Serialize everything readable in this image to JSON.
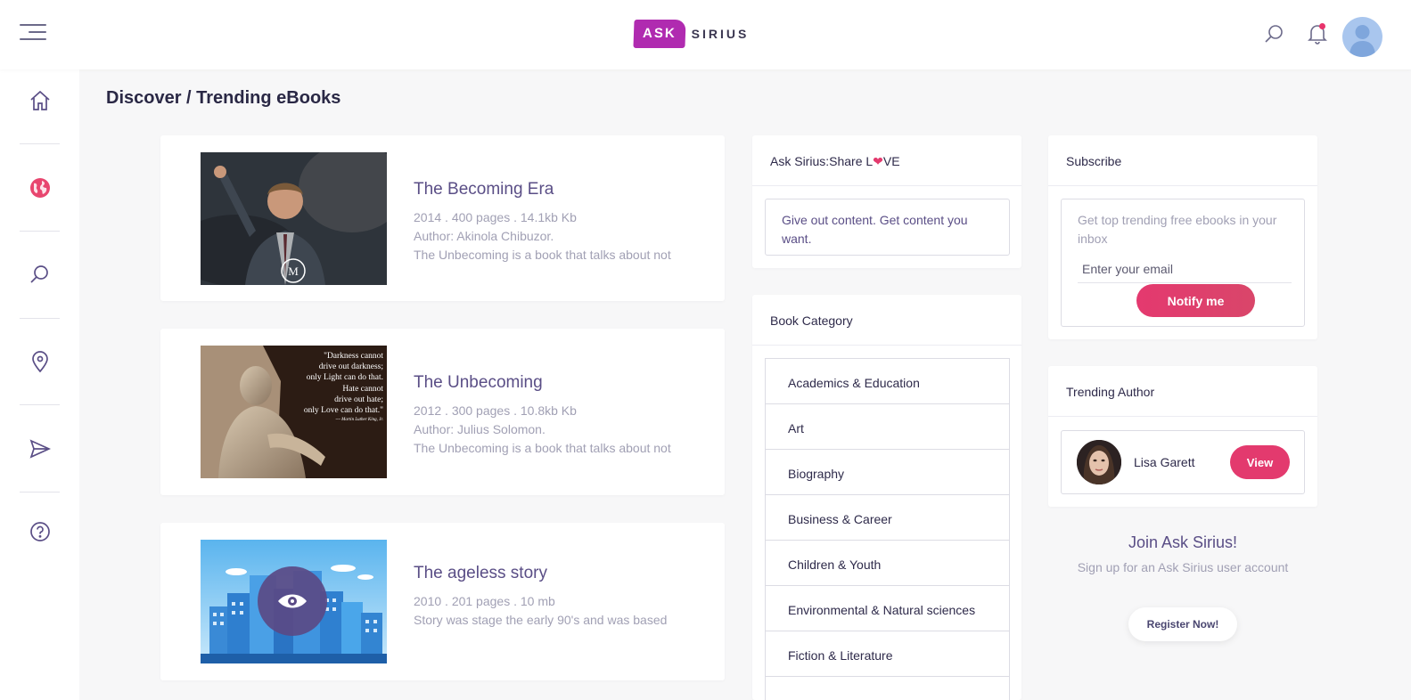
{
  "header": {
    "logo_ask": "ASK",
    "logo_sirius": "SIRIUS"
  },
  "sidebar": {
    "items": [
      {
        "name": "home",
        "active": false
      },
      {
        "name": "globe",
        "active": true
      },
      {
        "name": "search",
        "active": false
      },
      {
        "name": "location",
        "active": false
      },
      {
        "name": "send",
        "active": false
      },
      {
        "name": "help",
        "active": false
      }
    ]
  },
  "page": {
    "breadcrumb": "Discover / Trending eBooks"
  },
  "books": [
    {
      "title": "The Becoming Era",
      "meta": "2014 . 400 pages . 14.1kb Kb",
      "author": "Author: Akinola Chibuzor.",
      "desc": "The Unbecoming is a book that talks about not"
    },
    {
      "title": "The Unbecoming",
      "meta": "2012 . 300 pages . 10.8kb Kb",
      "author": "Author: Julius Solomon.",
      "desc": "The Unbecoming is a book that talks about not",
      "quote_lines": [
        "\"Darkness cannot",
        "drive out darkness;",
        "only Light can do that.",
        "Hate cannot",
        "drive out hate;",
        "only Love can do that.\"",
        "~~ Martin Luther King, Jr."
      ]
    },
    {
      "title": "The ageless story",
      "meta": "2010 . 201 pages . 10 mb",
      "desc": "Story was stage the early 90's and was based"
    }
  ],
  "share_panel": {
    "title_prefix": "Ask Sirius:Share L",
    "title_suffix": "VE",
    "body": "Give out content. Get content you want."
  },
  "category_panel": {
    "title": "Book Category",
    "items": [
      "Academics & Education",
      "Art",
      "Biography",
      "Business & Career",
      "Children & Youth",
      "Environmental & Natural sciences",
      "Fiction & Literature"
    ]
  },
  "subscribe_panel": {
    "title": "Subscribe",
    "description": "Get top trending free ebooks in your inbox",
    "email_placeholder": "Enter your email",
    "button": "Notify me"
  },
  "author_panel": {
    "title": "Trending Author",
    "author_name": "Lisa Garett",
    "button": "View"
  },
  "join": {
    "title": "Join Ask Sirius!",
    "subtitle": "Sign up for an Ask Sirius user account",
    "button": "Register Now!"
  },
  "colors": {
    "accent": "#e33a6e",
    "brand": "#b02bb0",
    "title_purple": "#5a4e86"
  }
}
